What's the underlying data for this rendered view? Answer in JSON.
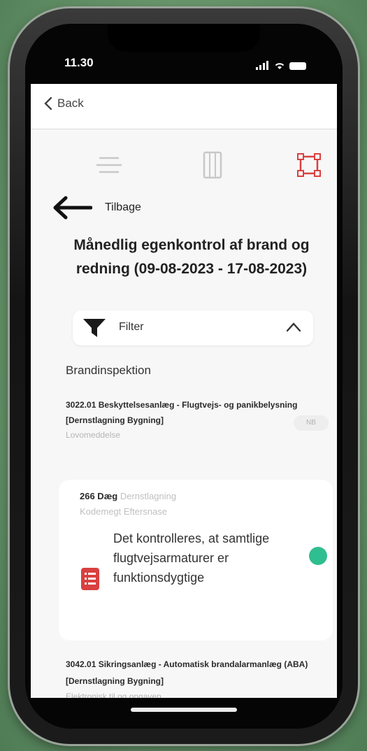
{
  "status_bar": {
    "time": "11.30"
  },
  "nav": {
    "back_label": "Back"
  },
  "tabs": [
    {
      "icon": "list-icon"
    },
    {
      "icon": "document-icon"
    },
    {
      "icon": "frame-icon",
      "active": true
    }
  ],
  "back_link": {
    "label": "Tilbage"
  },
  "page_title": "Månedlig egenkontrol af brand og redning (09-08-2023 - 17-08-2023)",
  "filter": {
    "label": "Filter"
  },
  "section_title": "Brandinspektion",
  "items": [
    {
      "title": "3022.01 Beskyttelsesanlæg - Flugtvejs- og panikbelysning [Dernstlagning Bygning]",
      "subtitle": "Lovomeddelse",
      "badge": "NB"
    }
  ],
  "card": {
    "head_bold": "266 Dæg",
    "head_muted": "Dernstlagning",
    "subtitle": "Kodemegt Eftersnase",
    "text": "Det kontrolleres, at samtlige flugtvejsarmaturer er funktionsdygtige"
  },
  "items_2": [
    {
      "title": "3042.01 Sikringsanlæg - Automatisk brandalarmanlæg (ABA) [Dernstlagning Bygning]",
      "subtitle": "Elektronisk til og opgaven"
    }
  ],
  "colors": {
    "accent_red": "#d94040",
    "status_green": "#2fbe90",
    "background_green": "#6f9b72"
  }
}
